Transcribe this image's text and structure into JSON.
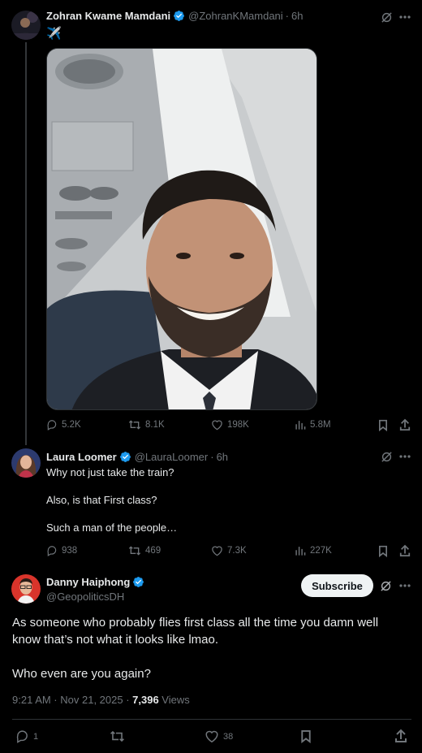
{
  "post": {
    "author_name": "Zohran Kwame Mamdani",
    "handle": "@ZohranKMamdani",
    "time": "6h",
    "text": "✈️",
    "stats": {
      "replies": "5.2K",
      "reposts": "8.1K",
      "likes": "198K",
      "views": "5.8M"
    }
  },
  "reply": {
    "author_name": "Laura Loomer",
    "handle": "@LauraLoomer",
    "time": "6h",
    "lines": [
      "Why not just take the train?",
      "",
      "Also, is that First class?",
      "",
      "Such a man of the people…"
    ],
    "stats": {
      "replies": "938",
      "reposts": "469",
      "likes": "7.3K",
      "views": "227K"
    }
  },
  "main": {
    "author_name": "Danny Haiphong",
    "handle": "@GeopoliticsDH",
    "subscribe_label": "Subscribe",
    "text_line1": "As someone who probably flies first class all the time you damn well",
    "text_line2": "know that’s not what it looks like lmao.",
    "text_line3": "Who even are you again?",
    "timestamp": "9:21 AM · Nov 21, 2025 · ",
    "views_count": "7,396",
    "views_label": " Views",
    "stats": {
      "replies": "1",
      "likes": "38"
    }
  },
  "colors": {
    "background": "#000000",
    "text": "#e7e9ea",
    "muted": "#71767b",
    "verified": "#1d9bf0",
    "divider": "#2f3336"
  },
  "icons": [
    "verified-badge",
    "grok-icon",
    "more-icon",
    "reply-icon",
    "repost-icon",
    "like-icon",
    "views-icon",
    "bookmark-icon",
    "share-icon"
  ]
}
